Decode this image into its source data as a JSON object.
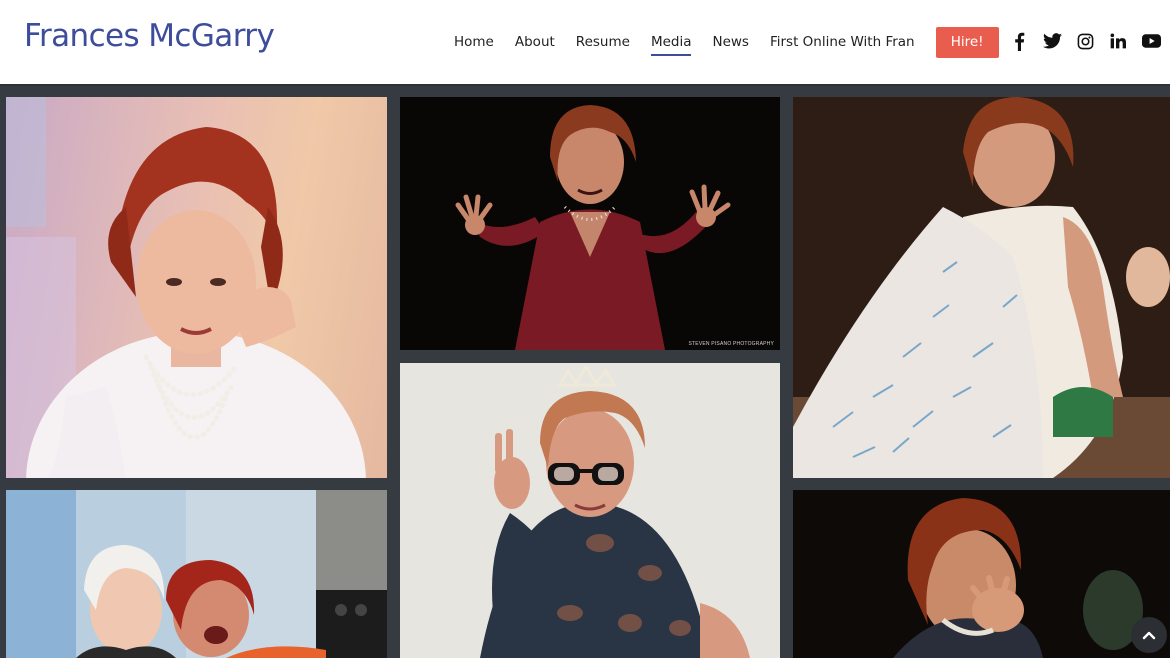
{
  "site": {
    "logo_text": "Frances McGarry"
  },
  "nav": {
    "items": [
      {
        "label": "Home",
        "active": false
      },
      {
        "label": "About",
        "active": false
      },
      {
        "label": "Resume",
        "active": false
      },
      {
        "label": "Media",
        "active": true
      },
      {
        "label": "News",
        "active": false
      },
      {
        "label": "First Online With Fran",
        "active": false
      }
    ],
    "hire_label": "Hire!"
  },
  "social": [
    "facebook-icon",
    "twitter-icon",
    "instagram-icon",
    "linkedin-icon",
    "youtube-icon"
  ],
  "gallery": {
    "photo_credit": "STEVEN PISANO PHOTOGRAPHY"
  },
  "colors": {
    "brand": "#3d4d9c",
    "accent": "#e85d4d",
    "background": "#363b41"
  }
}
